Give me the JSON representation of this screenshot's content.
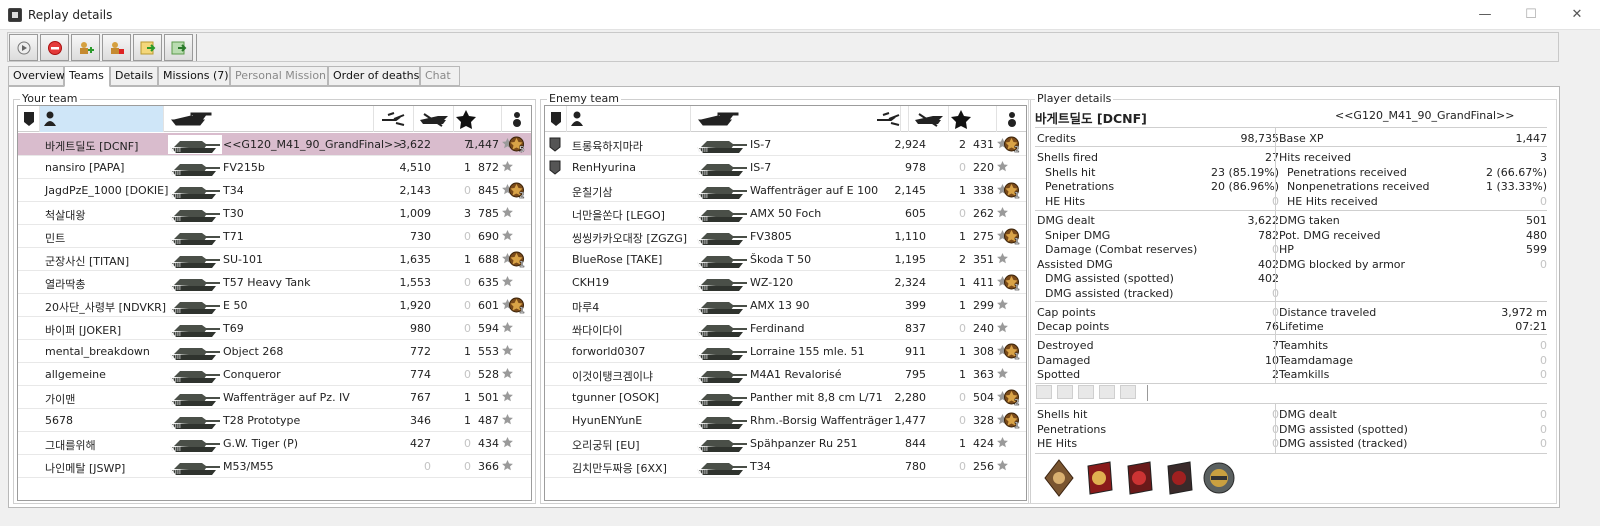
{
  "window": {
    "title": "Replay details",
    "minimize": "—",
    "maximize": "☐",
    "close": "✕"
  },
  "toolbar": {
    "buttons": [
      "play-icon",
      "stop-icon",
      "add-player-icon",
      "player-stats-icon",
      "export-icon",
      "export-all-icon"
    ]
  },
  "tabs": [
    {
      "label": "Overview"
    },
    {
      "label": "Teams"
    },
    {
      "label": "Details"
    },
    {
      "label": "Missions (7)"
    },
    {
      "label": "Personal Mission"
    },
    {
      "label": "Order of deaths"
    },
    {
      "label": "Chat"
    }
  ],
  "your_team": {
    "label": "Your team",
    "rows": [
      {
        "name": "바게트딜도 [DCNF]",
        "tank": "<<G120_M41_90_GrandFinal>>",
        "dmg": "3,622",
        "kills": "7",
        "xp": "1,447",
        "medal": "5"
      },
      {
        "name": "nansiro [PAPA]",
        "tank": "FV215b",
        "dmg": "4,510",
        "kills": "1",
        "xp": "872",
        "medal": ""
      },
      {
        "name": "JagdPzE_1000 [DOKIE]",
        "tank": "T34",
        "dmg": "2,143",
        "kills": "0",
        "xp": "845",
        "medal": "2"
      },
      {
        "name": "척살대왕",
        "tank": "T30",
        "dmg": "1,009",
        "kills": "3",
        "xp": "785",
        "medal": ""
      },
      {
        "name": "민트",
        "tank": "T71",
        "dmg": "730",
        "kills": "0",
        "xp": "690",
        "medal": ""
      },
      {
        "name": "군장사신 [TITAN]",
        "tank": "SU-101",
        "dmg": "1,635",
        "kills": "1",
        "xp": "688",
        "medal": "1"
      },
      {
        "name": "열라딱총",
        "tank": "T57 Heavy Tank",
        "dmg": "1,553",
        "kills": "0",
        "xp": "635",
        "medal": ""
      },
      {
        "name": "20사단_사령부 [NDVKR]",
        "tank": "E 50",
        "dmg": "1,920",
        "kills": "0",
        "xp": "601",
        "medal": "1"
      },
      {
        "name": "바이퍼 [JOKER]",
        "tank": "T69",
        "dmg": "980",
        "kills": "0",
        "xp": "594",
        "medal": ""
      },
      {
        "name": "mental_breakdown",
        "tank": "Object 268",
        "dmg": "772",
        "kills": "1",
        "xp": "553",
        "medal": ""
      },
      {
        "name": "allgemeine",
        "tank": "Conqueror",
        "dmg": "774",
        "kills": "0",
        "xp": "528",
        "medal": ""
      },
      {
        "name": "가이맨",
        "tank": "Waffenträger auf Pz. IV",
        "dmg": "767",
        "kills": "1",
        "xp": "501",
        "medal": ""
      },
      {
        "name": "5678",
        "tank": "T28 Prototype",
        "dmg": "346",
        "kills": "1",
        "xp": "487",
        "medal": ""
      },
      {
        "name": "그대를위해",
        "tank": "G.W. Tiger (P)",
        "dmg": "427",
        "kills": "0",
        "xp": "434",
        "medal": ""
      },
      {
        "name": "나인메탈 [JSWP]",
        "tank": "M53/M55",
        "dmg": "0",
        "kills": "0",
        "xp": "366",
        "medal": ""
      }
    ]
  },
  "enemy_team": {
    "label": "Enemy team",
    "rows": [
      {
        "name": "트롱육하지마라",
        "tank": "IS-7",
        "dmg": "2,924",
        "kills": "2",
        "xp": "431",
        "medal": "2"
      },
      {
        "name": "RenHyurina",
        "tank": "IS-7",
        "dmg": "978",
        "kills": "0",
        "xp": "220",
        "medal": ""
      },
      {
        "name": "운칠기삼",
        "tank": "Waffenträger auf E 100",
        "dmg": "2,145",
        "kills": "1",
        "xp": "338",
        "medal": "1"
      },
      {
        "name": "너만을쏜다 [LEGO]",
        "tank": "AMX 50 Foch",
        "dmg": "605",
        "kills": "0",
        "xp": "262",
        "medal": ""
      },
      {
        "name": "씽씽카카오대장 [ZGZG]",
        "tank": "FV3805",
        "dmg": "1,110",
        "kills": "1",
        "xp": "275",
        "medal": "1"
      },
      {
        "name": "BlueRose [TAKE]",
        "tank": "Škoda T 50",
        "dmg": "1,195",
        "kills": "2",
        "xp": "351",
        "medal": ""
      },
      {
        "name": "CKH19",
        "tank": "WZ-120",
        "dmg": "2,324",
        "kills": "1",
        "xp": "411",
        "medal": "1"
      },
      {
        "name": "마루4",
        "tank": "AMX 13 90",
        "dmg": "399",
        "kills": "1",
        "xp": "299",
        "medal": ""
      },
      {
        "name": "쏴다이다이",
        "tank": "Ferdinand",
        "dmg": "837",
        "kills": "0",
        "xp": "240",
        "medal": ""
      },
      {
        "name": "forworld0307",
        "tank": "Lorraine 155 mle. 51",
        "dmg": "911",
        "kills": "1",
        "xp": "308",
        "medal": "1"
      },
      {
        "name": "이것이탱크겜이냐",
        "tank": "M4A1 Revalorisé",
        "dmg": "795",
        "kills": "1",
        "xp": "363",
        "medal": ""
      },
      {
        "name": "tgunner [OSOK]",
        "tank": "Panther mit 8,8 cm L/71",
        "dmg": "2,280",
        "kills": "0",
        "xp": "504",
        "medal": "2"
      },
      {
        "name": "HyunENYunE",
        "tank": "Rhm.-Borsig Waffenträger",
        "dmg": "1,477",
        "kills": "0",
        "xp": "328",
        "medal": "1"
      },
      {
        "name": "오리궁뒤 [EU]",
        "tank": "Spähpanzer Ru 251",
        "dmg": "844",
        "kills": "1",
        "xp": "424",
        "medal": ""
      },
      {
        "name": "김치만두짜응 [6XX]",
        "tank": "T34",
        "dmg": "780",
        "kills": "0",
        "xp": "256",
        "medal": ""
      }
    ]
  },
  "player": {
    "label": "Player details",
    "name": "바게트딜도 [DCNF]",
    "vehicle": "<<G120_M41_90_GrandFinal>>",
    "left": [
      {
        "k": "Credits",
        "v": "98,735"
      },
      {
        "k": "Shells fired",
        "v": "27"
      },
      {
        "k": "Shells hit",
        "v": "23 (85.19%)",
        "i": 1
      },
      {
        "k": "Penetrations",
        "v": "20 (86.96%)",
        "i": 1
      },
      {
        "k": "HE Hits",
        "v": "0",
        "i": 1
      },
      {
        "k": "DMG dealt",
        "v": "3,622"
      },
      {
        "k": "Sniper DMG",
        "v": "782",
        "i": 1
      },
      {
        "k": "Damage (Combat reserves)",
        "v": "0",
        "i": 1
      },
      {
        "k": "Assisted DMG",
        "v": "402"
      },
      {
        "k": "DMG assisted (spotted)",
        "v": "402",
        "i": 1
      },
      {
        "k": "DMG assisted (tracked)",
        "v": "0",
        "i": 1
      },
      {
        "k": "Cap points",
        "v": "0"
      },
      {
        "k": "Decap points",
        "v": "76"
      },
      {
        "k": "Destroyed",
        "v": "7"
      },
      {
        "k": "Damaged",
        "v": "10"
      },
      {
        "k": "Spotted",
        "v": "2"
      }
    ],
    "right": [
      {
        "k": "Base XP",
        "v": "1,447"
      },
      {
        "k": "Hits received",
        "v": "3"
      },
      {
        "k": "Penetrations received",
        "v": "2 (66.67%)",
        "i": 1
      },
      {
        "k": "Nonpenetrations received",
        "v": "1 (33.33%)",
        "i": 1
      },
      {
        "k": "HE Hits received",
        "v": "0",
        "i": 1
      },
      {
        "k": "DMG taken",
        "v": "501"
      },
      {
        "k": "Pot. DMG received",
        "v": "480"
      },
      {
        "k": "HP",
        "v": "599"
      },
      {
        "k": "DMG blocked by armor",
        "v": "0"
      },
      {
        "k": "Distance traveled",
        "v": "3,972 m"
      },
      {
        "k": "Lifetime",
        "v": "07:21"
      },
      {
        "k": "Teamhits",
        "v": "0"
      },
      {
        "k": "Teamdamage",
        "v": "0"
      },
      {
        "k": "Teamkills",
        "v": "0"
      }
    ],
    "bottom_left": [
      {
        "k": "Shells hit",
        "v": "0"
      },
      {
        "k": "Penetrations",
        "v": "0"
      },
      {
        "k": "HE Hits",
        "v": "0"
      }
    ],
    "bottom_right": [
      {
        "k": "DMG dealt",
        "v": "0"
      },
      {
        "k": "DMG assisted (spotted)",
        "v": "0"
      },
      {
        "k": "DMG assisted (tracked)",
        "v": "0"
      }
    ],
    "awards": [
      "award-bronze-icon",
      "award-red-icon",
      "award-red-tank-icon",
      "award-dark-icon",
      "award-gold-icon"
    ]
  }
}
